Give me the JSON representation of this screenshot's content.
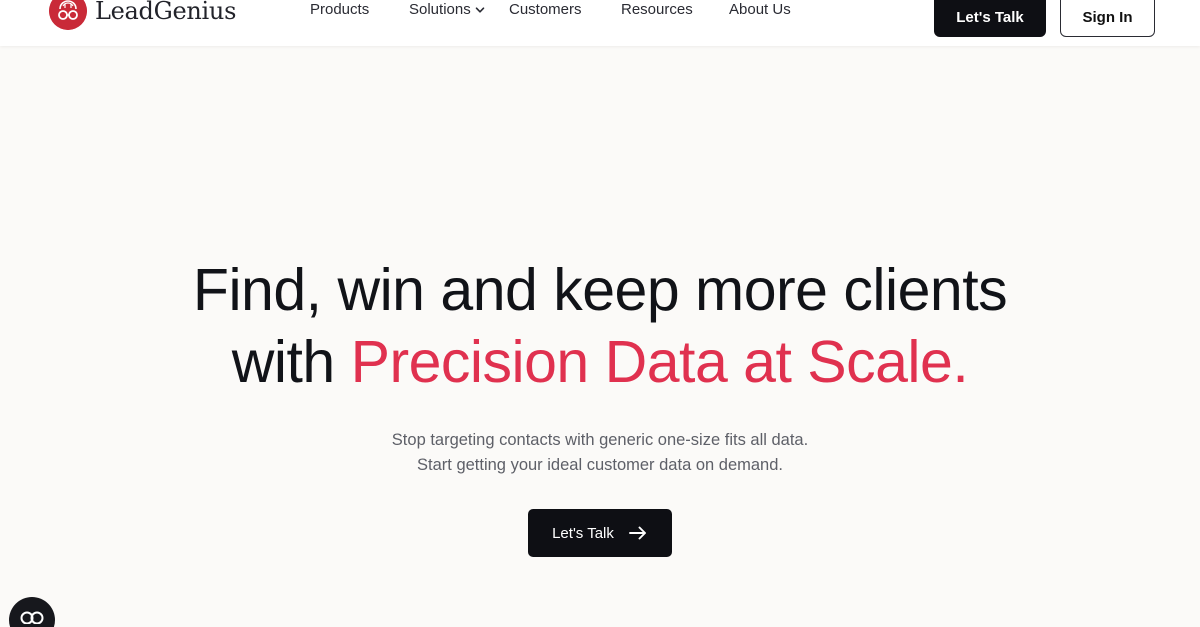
{
  "brand": {
    "name": "LeadGenius",
    "accent_color": "#e0314f",
    "logo_color": "#c92a38"
  },
  "nav": {
    "items": [
      {
        "label": "Products"
      },
      {
        "label": "Solutions",
        "has_dropdown": true
      },
      {
        "label": "Customers"
      },
      {
        "label": "Resources"
      },
      {
        "label": "About Us"
      }
    ]
  },
  "header_actions": {
    "primary_label": "Let's Talk",
    "secondary_label": "Sign In"
  },
  "hero": {
    "title_line1": "Find, win and keep more clients",
    "title_line2_prefix": "with ",
    "title_line2_accent": "Precision Data at Scale.",
    "subtitle_line1": "Stop targeting contacts with generic one-size fits all data.",
    "subtitle_line2": "Start getting your ideal customer data on demand.",
    "cta_label": "Let's Talk",
    "cta_icon": "arrow-right-icon"
  },
  "widgets": {
    "chat_icon": "chat-icon"
  }
}
